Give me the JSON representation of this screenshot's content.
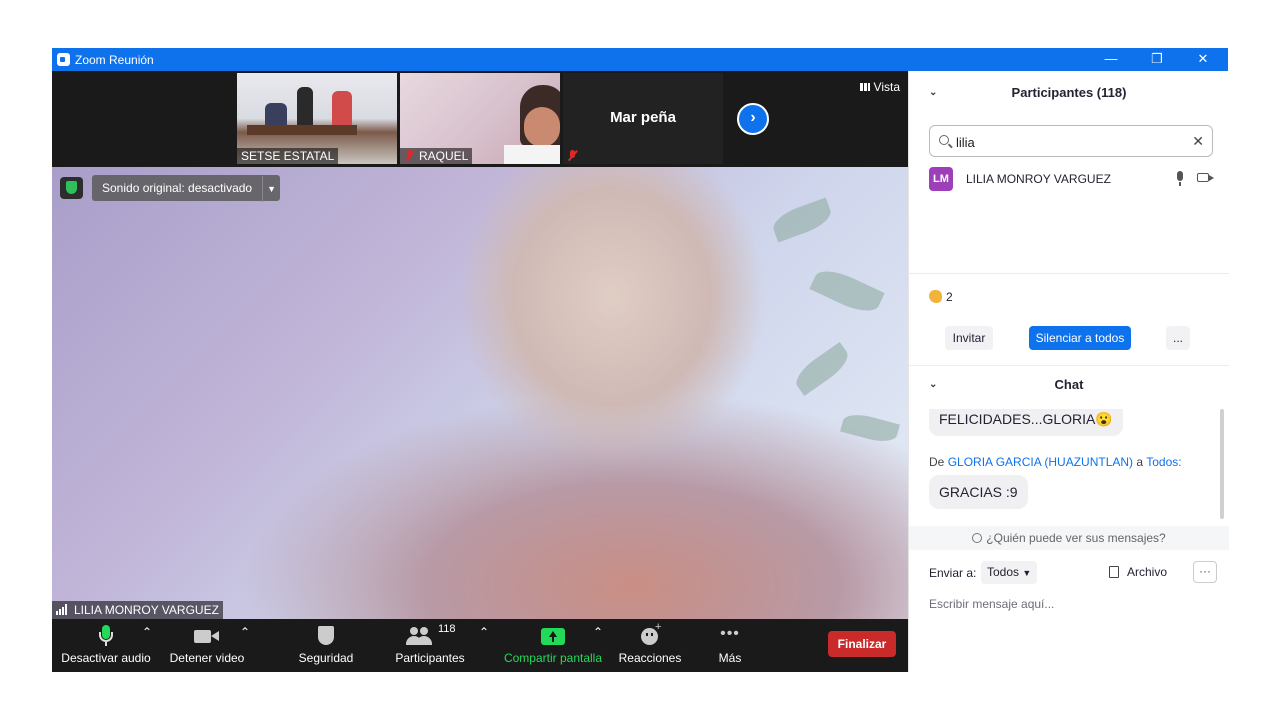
{
  "window": {
    "title": "Zoom Reunión",
    "controls": {
      "minimize": "—",
      "restore": "❐",
      "close": "✕"
    }
  },
  "thumbnails": [
    {
      "name": "SETSE ESTATAL",
      "muted": false
    },
    {
      "name": "RAQUEL",
      "muted": true
    },
    {
      "name": "Mar peña",
      "muted": true
    }
  ],
  "view_button": "Vista",
  "next_page_icon": "chevron-right-icon",
  "main_video": {
    "sound_label": "Sonido original: desactivado",
    "speaker_name": "LILIA MONROY VARGUEZ"
  },
  "toolbar": {
    "audio_label": "Desactivar audio",
    "video_label": "Detener video",
    "security_label": "Seguridad",
    "participants_label": "Participantes",
    "participants_count": "118",
    "share_label": "Compartir pantalla",
    "reactions_label": "Reacciones",
    "more_label": "Más",
    "end_label": "Finalizar"
  },
  "participants_panel": {
    "title": "Participantes (118)",
    "search_value": "lilia",
    "results": [
      {
        "initials": "LM",
        "name": "LILIA MONROY VARGUEZ",
        "avatar_color": "#9c3fb8"
      }
    ],
    "reaction_count": "2",
    "invite_label": "Invitar",
    "mute_all_label": "Silenciar a todos",
    "more_label": "..."
  },
  "chat": {
    "title": "Chat",
    "messages": [
      {
        "text": "FELICIDADES...GLORIA😮"
      },
      {
        "text": "GRACIAS :9"
      }
    ],
    "from_prefix": "De",
    "from_name": "GLORIA GARCIA (HUAZUNTLAN)",
    "from_mid": "a",
    "from_target": "Todos:",
    "who_sees": "¿Quién puede ver sus mensajes?",
    "send_to_label": "Enviar a:",
    "send_to_value": "Todos",
    "file_label": "Archivo",
    "more_label": "···",
    "input_placeholder": "Escribir mensaje aquí..."
  },
  "colors": {
    "zoom_blue": "#0e72ed",
    "end_red": "#c92b2b",
    "share_green": "#23d959",
    "avatar_purple": "#9c3fb8"
  }
}
